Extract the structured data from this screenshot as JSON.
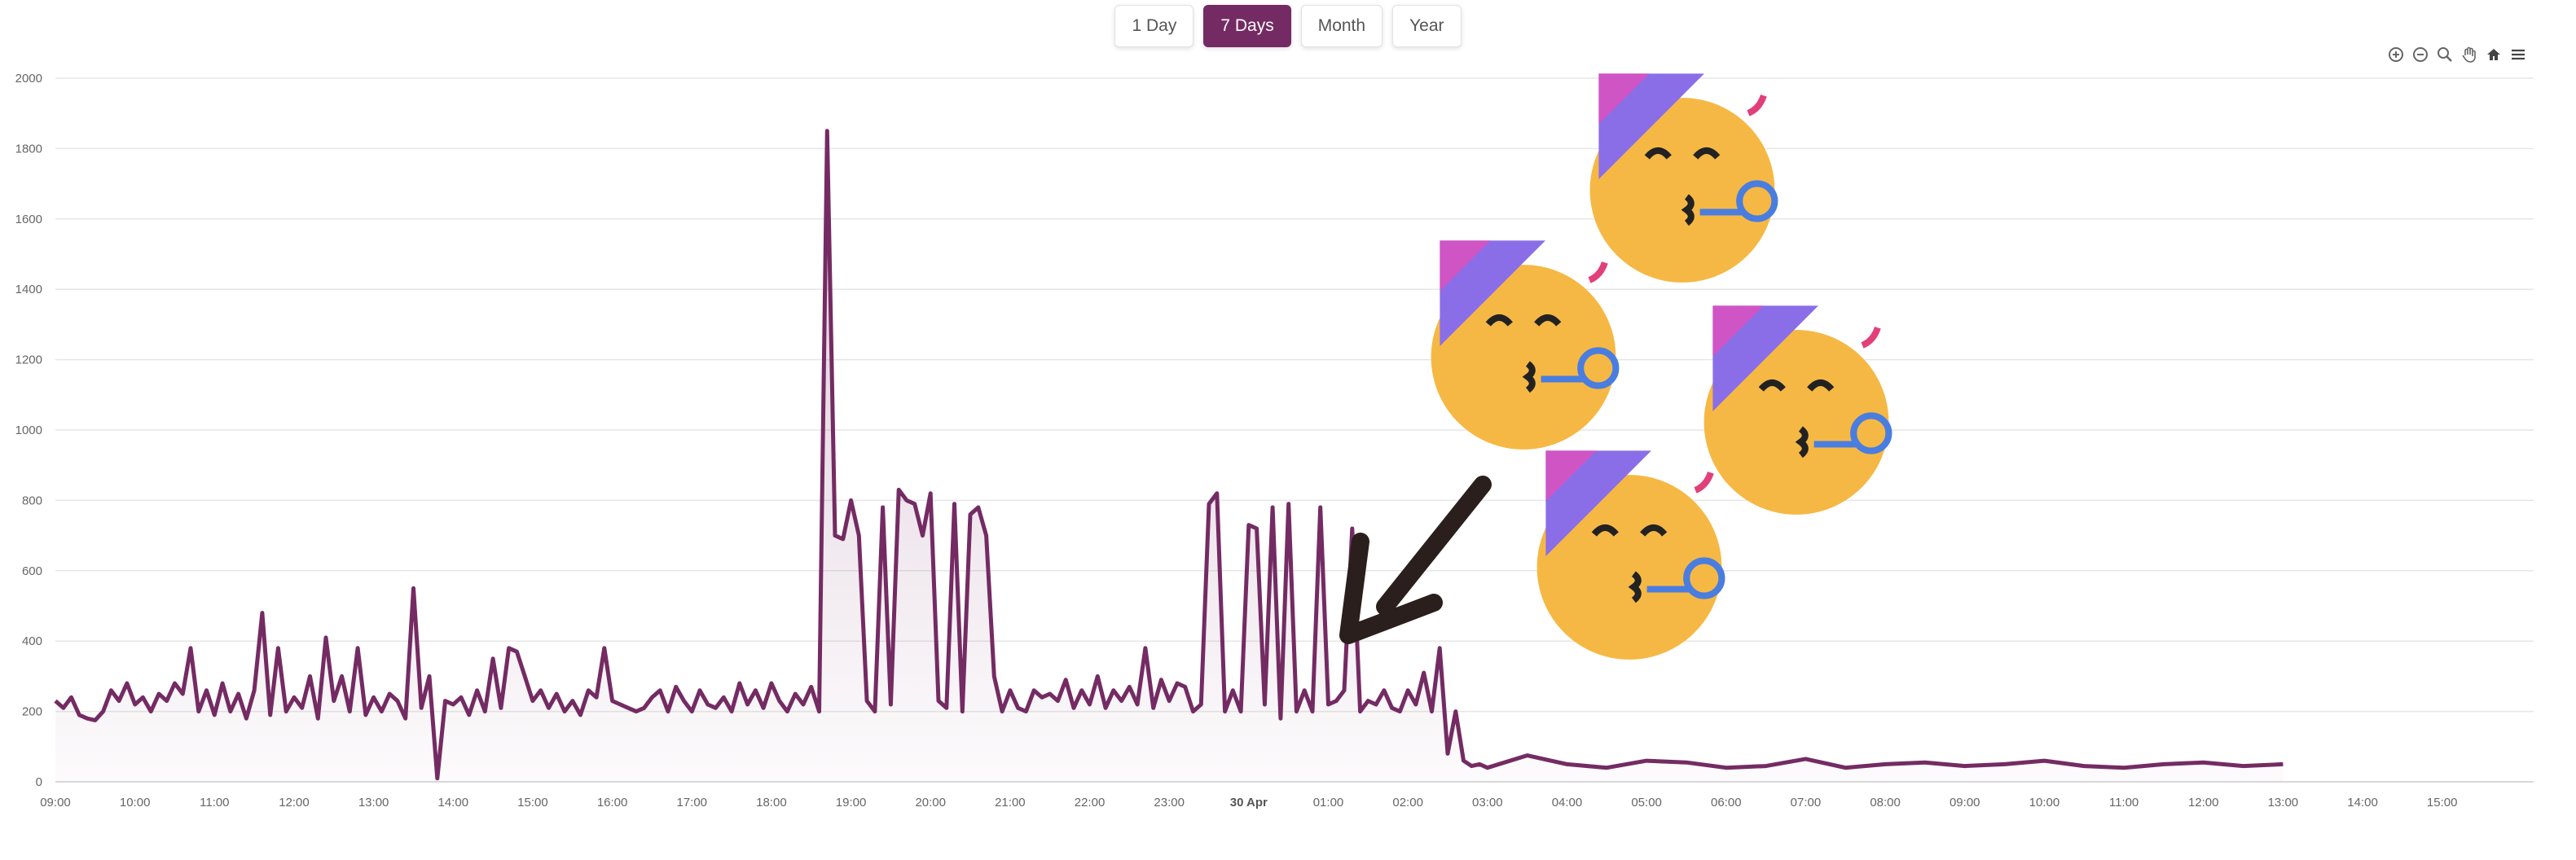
{
  "range_buttons": {
    "one_day": "1 Day",
    "seven_days": "7 Days",
    "month": "Month",
    "year": "Year",
    "active": "7 Days"
  },
  "toolbar_icons": [
    "zoom-in-icon",
    "zoom-out-icon",
    "magnifier-icon",
    "pan-hand-icon",
    "home-icon",
    "menu-icon"
  ],
  "colors": {
    "accent": "#742b63",
    "line": "#742b63",
    "fill": "#742b63"
  },
  "chart_data": {
    "type": "area",
    "title": "",
    "xlabel": "",
    "ylabel": "",
    "ylim": [
      0,
      2000
    ],
    "yticks": [
      "0",
      "200",
      "400",
      "600",
      "800",
      "1000",
      "1200",
      "1400",
      "1600",
      "1800",
      "2000"
    ],
    "xticks": [
      "09:00",
      "10:00",
      "11:00",
      "12:00",
      "13:00",
      "14:00",
      "15:00",
      "16:00",
      "17:00",
      "18:00",
      "19:00",
      "20:00",
      "21:00",
      "22:00",
      "23:00",
      "30 Apr",
      "01:00",
      "02:00",
      "03:00",
      "04:00",
      "05:00",
      "06:00",
      "07:00",
      "08:00",
      "09:00",
      "10:00",
      "11:00",
      "12:00",
      "13:00",
      "14:00",
      "15:00"
    ],
    "grid": true,
    "legend": "none",
    "x_hours_from_0900": [
      0,
      0.1,
      0.2,
      0.3,
      0.4,
      0.5,
      0.6,
      0.7,
      0.8,
      0.9,
      1.0,
      1.1,
      1.2,
      1.3,
      1.4,
      1.5,
      1.6,
      1.7,
      1.8,
      1.9,
      2.0,
      2.1,
      2.2,
      2.3,
      2.4,
      2.5,
      2.6,
      2.7,
      2.8,
      2.9,
      3.0,
      3.1,
      3.2,
      3.3,
      3.4,
      3.5,
      3.6,
      3.7,
      3.8,
      3.9,
      4.0,
      4.1,
      4.2,
      4.3,
      4.4,
      4.5,
      4.6,
      4.7,
      4.8,
      4.9,
      5.0,
      5.1,
      5.2,
      5.3,
      5.4,
      5.5,
      5.6,
      5.7,
      5.8,
      5.9,
      6.0,
      6.1,
      6.2,
      6.3,
      6.4,
      6.5,
      6.6,
      6.7,
      6.8,
      6.9,
      7.0,
      7.1,
      7.2,
      7.3,
      7.4,
      7.5,
      7.6,
      7.7,
      7.8,
      7.9,
      8.0,
      8.1,
      8.2,
      8.3,
      8.4,
      8.5,
      8.6,
      8.7,
      8.8,
      8.9,
      9.0,
      9.1,
      9.2,
      9.3,
      9.4,
      9.5,
      9.6,
      9.7,
      9.8,
      9.9,
      10.0,
      10.1,
      10.2,
      10.3,
      10.4,
      10.5,
      10.6,
      10.7,
      10.8,
      10.9,
      11.0,
      11.1,
      11.2,
      11.3,
      11.4,
      11.5,
      11.6,
      11.7,
      11.8,
      11.9,
      12.0,
      12.1,
      12.2,
      12.3,
      12.4,
      12.5,
      12.6,
      12.7,
      12.8,
      12.9,
      13.0,
      13.1,
      13.2,
      13.3,
      13.4,
      13.5,
      13.6,
      13.7,
      13.8,
      13.9,
      14.0,
      14.1,
      14.2,
      14.3,
      14.4,
      14.5,
      14.6,
      14.7,
      14.8,
      14.9,
      15.0,
      15.1,
      15.2,
      15.3,
      15.4,
      15.5,
      15.6,
      15.7,
      15.8,
      15.9,
      16.0,
      16.1,
      16.2,
      16.3,
      16.4,
      16.5,
      16.6,
      16.7,
      16.8,
      16.9,
      17.0,
      17.1,
      17.2,
      17.3,
      17.4,
      17.5,
      17.6,
      17.7,
      17.8,
      17.9,
      18.0,
      18.5,
      19.0,
      19.5,
      20.0,
      20.5,
      21.0,
      21.5,
      22.0,
      22.5,
      23.0,
      23.5,
      24.0,
      24.5,
      25.0,
      25.5,
      26.0,
      26.5,
      27.0,
      27.5,
      28.0,
      28.5,
      29.0,
      29.5,
      30.0,
      30.5,
      31.0
    ],
    "series": [
      {
        "values": [
          230,
          210,
          240,
          190,
          180,
          175,
          200,
          260,
          230,
          280,
          220,
          240,
          200,
          250,
          230,
          280,
          250,
          380,
          200,
          260,
          190,
          280,
          200,
          250,
          180,
          260,
          480,
          190,
          380,
          200,
          240,
          210,
          300,
          180,
          410,
          230,
          300,
          200,
          380,
          190,
          240,
          200,
          250,
          230,
          180,
          550,
          210,
          300,
          10,
          230,
          220,
          240,
          190,
          260,
          200,
          350,
          210,
          380,
          370,
          300,
          230,
          260,
          210,
          250,
          200,
          230,
          190,
          260,
          240,
          380,
          230,
          220,
          210,
          200,
          210,
          240,
          260,
          200,
          270,
          230,
          200,
          260,
          220,
          210,
          240,
          200,
          280,
          220,
          260,
          210,
          280,
          230,
          200,
          250,
          220,
          270,
          200,
          1850,
          700,
          690,
          800,
          700,
          230,
          200,
          780,
          220,
          830,
          800,
          790,
          700,
          820,
          230,
          210,
          790,
          200,
          760,
          780,
          700,
          300,
          200,
          260,
          210,
          200,
          260,
          240,
          250,
          230,
          290,
          210,
          260,
          220,
          300,
          210,
          260,
          230,
          270,
          220,
          380,
          210,
          290,
          230,
          280,
          270,
          200,
          220,
          790,
          820,
          200,
          260,
          200,
          730,
          720,
          220,
          780,
          180,
          790,
          200,
          260,
          200,
          780,
          220,
          230,
          260,
          720,
          200,
          230,
          220,
          260,
          210,
          200,
          260,
          220,
          310,
          200,
          380,
          80,
          200,
          60,
          45,
          50,
          40,
          75,
          50,
          40,
          60,
          55,
          40,
          45,
          65,
          40,
          50,
          55,
          45,
          50,
          60,
          45,
          40,
          50,
          55,
          45,
          50
        ]
      }
    ]
  }
}
